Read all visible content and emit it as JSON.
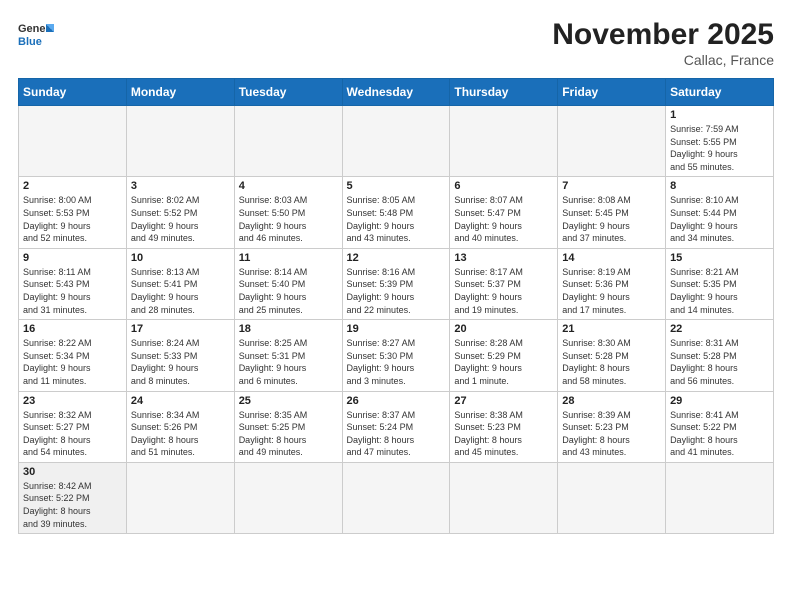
{
  "header": {
    "logo_general": "General",
    "logo_blue": "Blue",
    "month_title": "November 2025",
    "location": "Callac, France"
  },
  "days_of_week": [
    "Sunday",
    "Monday",
    "Tuesday",
    "Wednesday",
    "Thursday",
    "Friday",
    "Saturday"
  ],
  "weeks": [
    [
      {
        "day": "",
        "info": ""
      },
      {
        "day": "",
        "info": ""
      },
      {
        "day": "",
        "info": ""
      },
      {
        "day": "",
        "info": ""
      },
      {
        "day": "",
        "info": ""
      },
      {
        "day": "",
        "info": ""
      },
      {
        "day": "1",
        "info": "Sunrise: 7:59 AM\nSunset: 5:55 PM\nDaylight: 9 hours\nand 55 minutes."
      }
    ],
    [
      {
        "day": "2",
        "info": "Sunrise: 8:00 AM\nSunset: 5:53 PM\nDaylight: 9 hours\nand 52 minutes."
      },
      {
        "day": "3",
        "info": "Sunrise: 8:02 AM\nSunset: 5:52 PM\nDaylight: 9 hours\nand 49 minutes."
      },
      {
        "day": "4",
        "info": "Sunrise: 8:03 AM\nSunset: 5:50 PM\nDaylight: 9 hours\nand 46 minutes."
      },
      {
        "day": "5",
        "info": "Sunrise: 8:05 AM\nSunset: 5:48 PM\nDaylight: 9 hours\nand 43 minutes."
      },
      {
        "day": "6",
        "info": "Sunrise: 8:07 AM\nSunset: 5:47 PM\nDaylight: 9 hours\nand 40 minutes."
      },
      {
        "day": "7",
        "info": "Sunrise: 8:08 AM\nSunset: 5:45 PM\nDaylight: 9 hours\nand 37 minutes."
      },
      {
        "day": "8",
        "info": "Sunrise: 8:10 AM\nSunset: 5:44 PM\nDaylight: 9 hours\nand 34 minutes."
      }
    ],
    [
      {
        "day": "9",
        "info": "Sunrise: 8:11 AM\nSunset: 5:43 PM\nDaylight: 9 hours\nand 31 minutes."
      },
      {
        "day": "10",
        "info": "Sunrise: 8:13 AM\nSunset: 5:41 PM\nDaylight: 9 hours\nand 28 minutes."
      },
      {
        "day": "11",
        "info": "Sunrise: 8:14 AM\nSunset: 5:40 PM\nDaylight: 9 hours\nand 25 minutes."
      },
      {
        "day": "12",
        "info": "Sunrise: 8:16 AM\nSunset: 5:39 PM\nDaylight: 9 hours\nand 22 minutes."
      },
      {
        "day": "13",
        "info": "Sunrise: 8:17 AM\nSunset: 5:37 PM\nDaylight: 9 hours\nand 19 minutes."
      },
      {
        "day": "14",
        "info": "Sunrise: 8:19 AM\nSunset: 5:36 PM\nDaylight: 9 hours\nand 17 minutes."
      },
      {
        "day": "15",
        "info": "Sunrise: 8:21 AM\nSunset: 5:35 PM\nDaylight: 9 hours\nand 14 minutes."
      }
    ],
    [
      {
        "day": "16",
        "info": "Sunrise: 8:22 AM\nSunset: 5:34 PM\nDaylight: 9 hours\nand 11 minutes."
      },
      {
        "day": "17",
        "info": "Sunrise: 8:24 AM\nSunset: 5:33 PM\nDaylight: 9 hours\nand 8 minutes."
      },
      {
        "day": "18",
        "info": "Sunrise: 8:25 AM\nSunset: 5:31 PM\nDaylight: 9 hours\nand 6 minutes."
      },
      {
        "day": "19",
        "info": "Sunrise: 8:27 AM\nSunset: 5:30 PM\nDaylight: 9 hours\nand 3 minutes."
      },
      {
        "day": "20",
        "info": "Sunrise: 8:28 AM\nSunset: 5:29 PM\nDaylight: 9 hours\nand 1 minute."
      },
      {
        "day": "21",
        "info": "Sunrise: 8:30 AM\nSunset: 5:28 PM\nDaylight: 8 hours\nand 58 minutes."
      },
      {
        "day": "22",
        "info": "Sunrise: 8:31 AM\nSunset: 5:28 PM\nDaylight: 8 hours\nand 56 minutes."
      }
    ],
    [
      {
        "day": "23",
        "info": "Sunrise: 8:32 AM\nSunset: 5:27 PM\nDaylight: 8 hours\nand 54 minutes."
      },
      {
        "day": "24",
        "info": "Sunrise: 8:34 AM\nSunset: 5:26 PM\nDaylight: 8 hours\nand 51 minutes."
      },
      {
        "day": "25",
        "info": "Sunrise: 8:35 AM\nSunset: 5:25 PM\nDaylight: 8 hours\nand 49 minutes."
      },
      {
        "day": "26",
        "info": "Sunrise: 8:37 AM\nSunset: 5:24 PM\nDaylight: 8 hours\nand 47 minutes."
      },
      {
        "day": "27",
        "info": "Sunrise: 8:38 AM\nSunset: 5:23 PM\nDaylight: 8 hours\nand 45 minutes."
      },
      {
        "day": "28",
        "info": "Sunrise: 8:39 AM\nSunset: 5:23 PM\nDaylight: 8 hours\nand 43 minutes."
      },
      {
        "day": "29",
        "info": "Sunrise: 8:41 AM\nSunset: 5:22 PM\nDaylight: 8 hours\nand 41 minutes."
      }
    ],
    [
      {
        "day": "30",
        "info": "Sunrise: 8:42 AM\nSunset: 5:22 PM\nDaylight: 8 hours\nand 39 minutes."
      },
      {
        "day": "",
        "info": ""
      },
      {
        "day": "",
        "info": ""
      },
      {
        "day": "",
        "info": ""
      },
      {
        "day": "",
        "info": ""
      },
      {
        "day": "",
        "info": ""
      },
      {
        "day": "",
        "info": ""
      }
    ]
  ]
}
